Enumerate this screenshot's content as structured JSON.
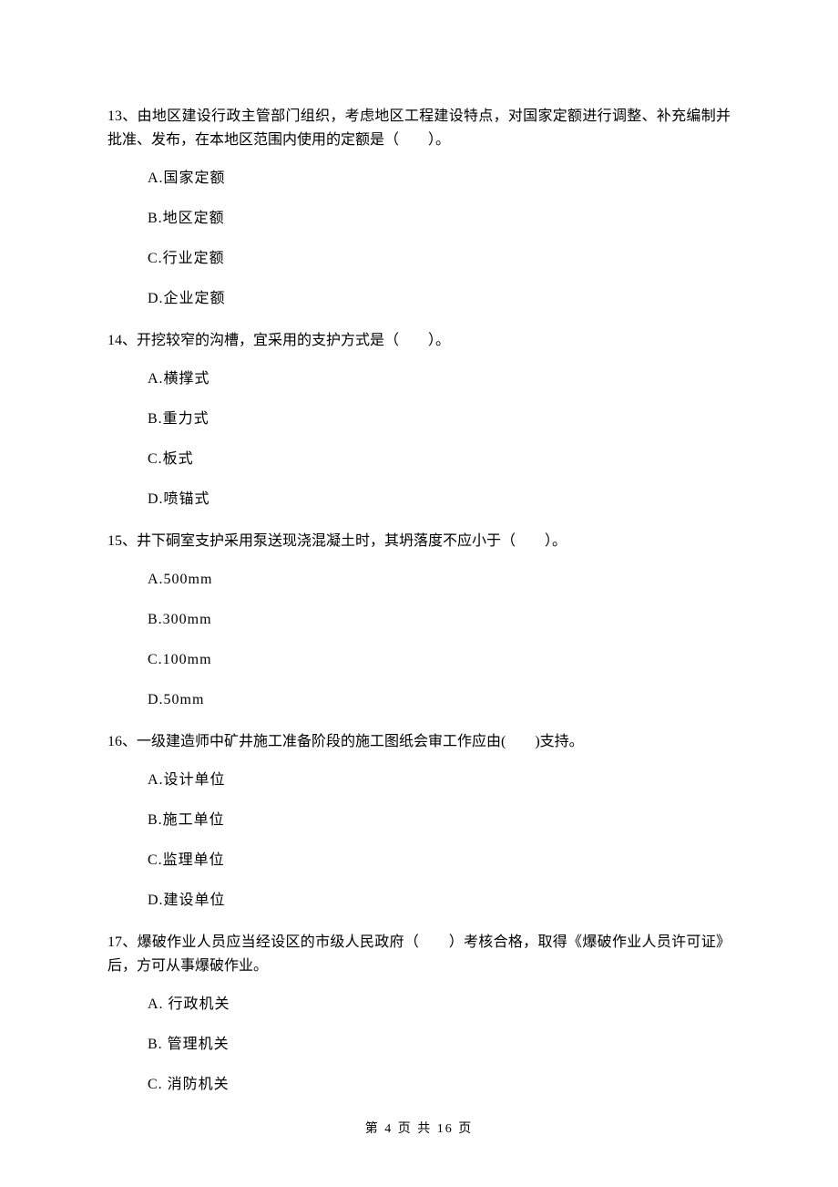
{
  "questions": [
    {
      "stem": "13、由地区建设行政主管部门组织，考虑地区工程建设特点，对国家定额进行调整、补充编制并批准、发布，在本地区范围内使用的定额是（　　）。",
      "options": [
        "A.国家定额",
        "B.地区定额",
        "C.行业定额",
        "D.企业定额"
      ]
    },
    {
      "stem": "14、开挖较窄的沟槽，宜采用的支护方式是（　　）。",
      "options": [
        "A.横撑式",
        "B.重力式",
        "C.板式",
        "D.喷锚式"
      ]
    },
    {
      "stem": "15、井下硐室支护采用泵送现浇混凝土时，其坍落度不应小于（　　）。",
      "options": [
        "A.500mm",
        "B.300mm",
        "C.100mm",
        "D.50mm"
      ]
    },
    {
      "stem": "16、一级建造师中矿井施工准备阶段的施工图纸会审工作应由(　　)支持。",
      "options": [
        "A.设计单位",
        "B.施工单位",
        "C.监理单位",
        "D.建设单位"
      ]
    },
    {
      "stem": "17、爆破作业人员应当经设区的市级人民政府（　　）考核合格，取得《爆破作业人员许可证》后，方可从事爆破作业。",
      "options": [
        "A. 行政机关",
        "B. 管理机关",
        "C. 消防机关"
      ]
    }
  ],
  "footer": "第 4 页 共 16 页"
}
